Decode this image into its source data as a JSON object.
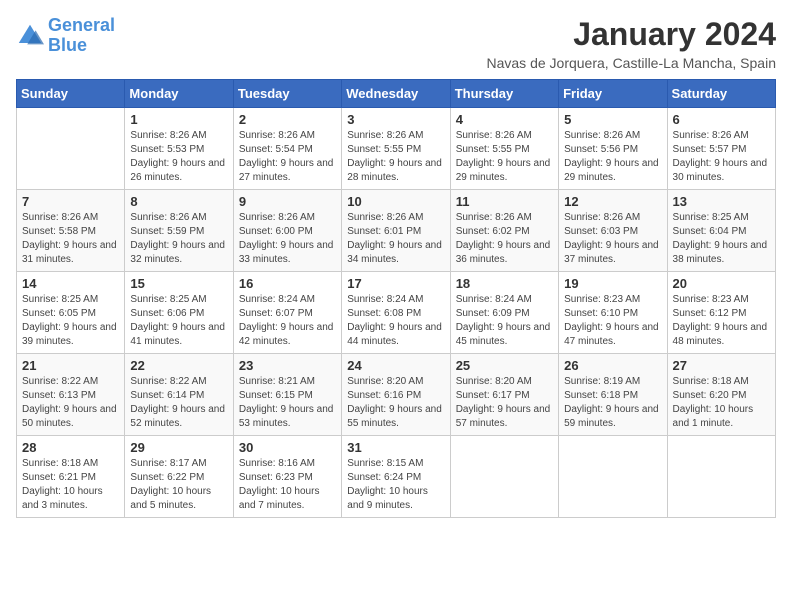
{
  "logo": {
    "text_general": "General",
    "text_blue": "Blue"
  },
  "header": {
    "title": "January 2024",
    "subtitle": "Navas de Jorquera, Castille-La Mancha, Spain"
  },
  "weekdays": [
    "Sunday",
    "Monday",
    "Tuesday",
    "Wednesday",
    "Thursday",
    "Friday",
    "Saturday"
  ],
  "weeks": [
    [
      {
        "day": "",
        "sunrise": "",
        "sunset": "",
        "daylight": ""
      },
      {
        "day": "1",
        "sunrise": "Sunrise: 8:26 AM",
        "sunset": "Sunset: 5:53 PM",
        "daylight": "Daylight: 9 hours and 26 minutes."
      },
      {
        "day": "2",
        "sunrise": "Sunrise: 8:26 AM",
        "sunset": "Sunset: 5:54 PM",
        "daylight": "Daylight: 9 hours and 27 minutes."
      },
      {
        "day": "3",
        "sunrise": "Sunrise: 8:26 AM",
        "sunset": "Sunset: 5:55 PM",
        "daylight": "Daylight: 9 hours and 28 minutes."
      },
      {
        "day": "4",
        "sunrise": "Sunrise: 8:26 AM",
        "sunset": "Sunset: 5:55 PM",
        "daylight": "Daylight: 9 hours and 29 minutes."
      },
      {
        "day": "5",
        "sunrise": "Sunrise: 8:26 AM",
        "sunset": "Sunset: 5:56 PM",
        "daylight": "Daylight: 9 hours and 29 minutes."
      },
      {
        "day": "6",
        "sunrise": "Sunrise: 8:26 AM",
        "sunset": "Sunset: 5:57 PM",
        "daylight": "Daylight: 9 hours and 30 minutes."
      }
    ],
    [
      {
        "day": "7",
        "sunrise": "Sunrise: 8:26 AM",
        "sunset": "Sunset: 5:58 PM",
        "daylight": "Daylight: 9 hours and 31 minutes."
      },
      {
        "day": "8",
        "sunrise": "Sunrise: 8:26 AM",
        "sunset": "Sunset: 5:59 PM",
        "daylight": "Daylight: 9 hours and 32 minutes."
      },
      {
        "day": "9",
        "sunrise": "Sunrise: 8:26 AM",
        "sunset": "Sunset: 6:00 PM",
        "daylight": "Daylight: 9 hours and 33 minutes."
      },
      {
        "day": "10",
        "sunrise": "Sunrise: 8:26 AM",
        "sunset": "Sunset: 6:01 PM",
        "daylight": "Daylight: 9 hours and 34 minutes."
      },
      {
        "day": "11",
        "sunrise": "Sunrise: 8:26 AM",
        "sunset": "Sunset: 6:02 PM",
        "daylight": "Daylight: 9 hours and 36 minutes."
      },
      {
        "day": "12",
        "sunrise": "Sunrise: 8:26 AM",
        "sunset": "Sunset: 6:03 PM",
        "daylight": "Daylight: 9 hours and 37 minutes."
      },
      {
        "day": "13",
        "sunrise": "Sunrise: 8:25 AM",
        "sunset": "Sunset: 6:04 PM",
        "daylight": "Daylight: 9 hours and 38 minutes."
      }
    ],
    [
      {
        "day": "14",
        "sunrise": "Sunrise: 8:25 AM",
        "sunset": "Sunset: 6:05 PM",
        "daylight": "Daylight: 9 hours and 39 minutes."
      },
      {
        "day": "15",
        "sunrise": "Sunrise: 8:25 AM",
        "sunset": "Sunset: 6:06 PM",
        "daylight": "Daylight: 9 hours and 41 minutes."
      },
      {
        "day": "16",
        "sunrise": "Sunrise: 8:24 AM",
        "sunset": "Sunset: 6:07 PM",
        "daylight": "Daylight: 9 hours and 42 minutes."
      },
      {
        "day": "17",
        "sunrise": "Sunrise: 8:24 AM",
        "sunset": "Sunset: 6:08 PM",
        "daylight": "Daylight: 9 hours and 44 minutes."
      },
      {
        "day": "18",
        "sunrise": "Sunrise: 8:24 AM",
        "sunset": "Sunset: 6:09 PM",
        "daylight": "Daylight: 9 hours and 45 minutes."
      },
      {
        "day": "19",
        "sunrise": "Sunrise: 8:23 AM",
        "sunset": "Sunset: 6:10 PM",
        "daylight": "Daylight: 9 hours and 47 minutes."
      },
      {
        "day": "20",
        "sunrise": "Sunrise: 8:23 AM",
        "sunset": "Sunset: 6:12 PM",
        "daylight": "Daylight: 9 hours and 48 minutes."
      }
    ],
    [
      {
        "day": "21",
        "sunrise": "Sunrise: 8:22 AM",
        "sunset": "Sunset: 6:13 PM",
        "daylight": "Daylight: 9 hours and 50 minutes."
      },
      {
        "day": "22",
        "sunrise": "Sunrise: 8:22 AM",
        "sunset": "Sunset: 6:14 PM",
        "daylight": "Daylight: 9 hours and 52 minutes."
      },
      {
        "day": "23",
        "sunrise": "Sunrise: 8:21 AM",
        "sunset": "Sunset: 6:15 PM",
        "daylight": "Daylight: 9 hours and 53 minutes."
      },
      {
        "day": "24",
        "sunrise": "Sunrise: 8:20 AM",
        "sunset": "Sunset: 6:16 PM",
        "daylight": "Daylight: 9 hours and 55 minutes."
      },
      {
        "day": "25",
        "sunrise": "Sunrise: 8:20 AM",
        "sunset": "Sunset: 6:17 PM",
        "daylight": "Daylight: 9 hours and 57 minutes."
      },
      {
        "day": "26",
        "sunrise": "Sunrise: 8:19 AM",
        "sunset": "Sunset: 6:18 PM",
        "daylight": "Daylight: 9 hours and 59 minutes."
      },
      {
        "day": "27",
        "sunrise": "Sunrise: 8:18 AM",
        "sunset": "Sunset: 6:20 PM",
        "daylight": "Daylight: 10 hours and 1 minute."
      }
    ],
    [
      {
        "day": "28",
        "sunrise": "Sunrise: 8:18 AM",
        "sunset": "Sunset: 6:21 PM",
        "daylight": "Daylight: 10 hours and 3 minutes."
      },
      {
        "day": "29",
        "sunrise": "Sunrise: 8:17 AM",
        "sunset": "Sunset: 6:22 PM",
        "daylight": "Daylight: 10 hours and 5 minutes."
      },
      {
        "day": "30",
        "sunrise": "Sunrise: 8:16 AM",
        "sunset": "Sunset: 6:23 PM",
        "daylight": "Daylight: 10 hours and 7 minutes."
      },
      {
        "day": "31",
        "sunrise": "Sunrise: 8:15 AM",
        "sunset": "Sunset: 6:24 PM",
        "daylight": "Daylight: 10 hours and 9 minutes."
      },
      {
        "day": "",
        "sunrise": "",
        "sunset": "",
        "daylight": ""
      },
      {
        "day": "",
        "sunrise": "",
        "sunset": "",
        "daylight": ""
      },
      {
        "day": "",
        "sunrise": "",
        "sunset": "",
        "daylight": ""
      }
    ]
  ]
}
